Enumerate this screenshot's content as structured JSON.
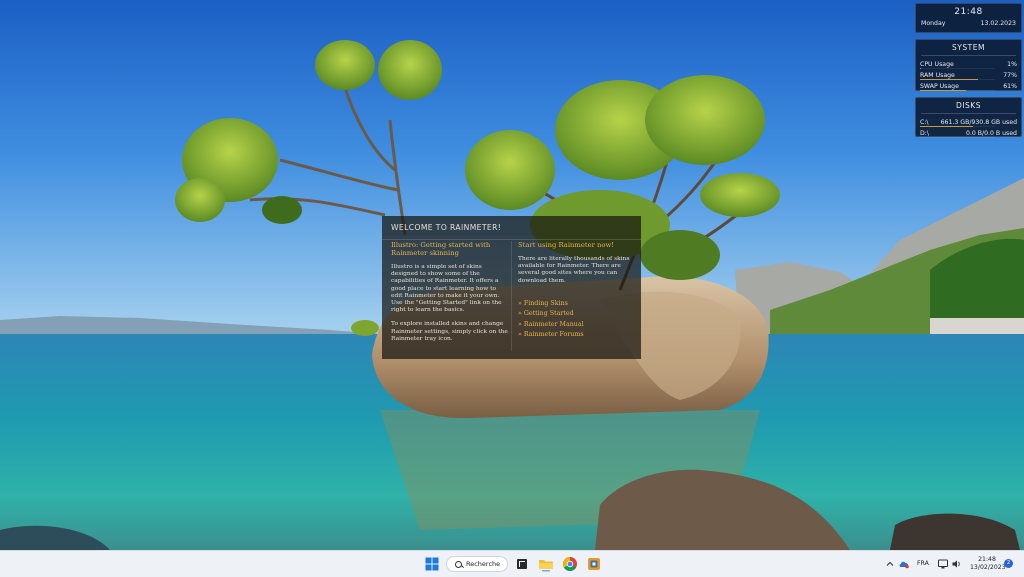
{
  "rainmeter": {
    "clock": {
      "time": "21:48",
      "day": "Monday",
      "date": "13.02.2023"
    },
    "system": {
      "title": "SYSTEM",
      "stats": [
        {
          "label": "CPU Usage",
          "value": "1%",
          "fraction": 0.01
        },
        {
          "label": "RAM Usage",
          "value": "77%",
          "fraction": 0.77
        },
        {
          "label": "SWAP Usage",
          "value": "61%",
          "fraction": 0.61
        }
      ]
    },
    "disks": {
      "title": "DISKS",
      "items": [
        {
          "label": "C:\\",
          "value": "661.3 GB/930.8 GB used",
          "fraction": 0.71
        },
        {
          "label": "D:\\",
          "value": "0.0 B/0.0 B used",
          "fraction": 0.0
        }
      ]
    }
  },
  "welcome": {
    "title": "WELCOME TO RAINMETER!",
    "left": {
      "heading": "Illustro: Getting started with Rainmeter skinning",
      "para1": "Illustro is a simple set of skins designed to show some of the capabilities of Rainmeter. It offers a good place to start learning how to edit Rainmeter to make it your own. Use the \"Getting Started\" link on the right to learn the basics.",
      "para2": "To explore installed skins and change Rainmeter settings, simply click on the Rainmeter tray icon."
    },
    "right": {
      "heading": "Start using Rainmeter now!",
      "para1": "There are literally thousands of skins available for Rainmeter. There are several good sites where you can download them.",
      "links": [
        "» Finding Skins",
        "» Getting Started",
        "» Rainmeter Manual",
        "» Rainmeter Forums"
      ]
    }
  },
  "taskbar": {
    "search_label": "Recherche",
    "language": "FRA",
    "time": "21:48",
    "date": "13/02/2023",
    "notifications": "2",
    "icons": [
      "windows-start-icon",
      "search-icon",
      "task-view-icon",
      "file-explorer-icon",
      "chrome-icon",
      "rainmeter-icon",
      "chevron-up-icon",
      "cloud-icon",
      "network-icon",
      "speaker-icon"
    ]
  },
  "colors": {
    "accent": "#e8b34a",
    "widget_bg": "#0a162a",
    "taskbar_bg": "#eef1f6"
  }
}
